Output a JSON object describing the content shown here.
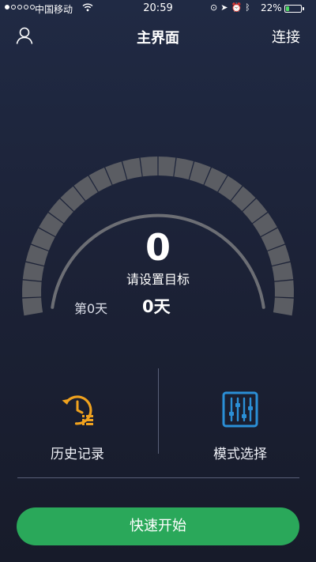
{
  "status_bar": {
    "carrier": "中国移动",
    "time": "20:59",
    "battery_percent": "22%",
    "battery_level": 0.22,
    "wifi_icon": "wifi-icon",
    "system_icons": [
      "orientation-lock-icon",
      "location-arrow-icon",
      "alarm-icon",
      "bluetooth-icon"
    ]
  },
  "header": {
    "title": "主界面",
    "connect_label": "连接",
    "profile_icon": "user-icon"
  },
  "gauge": {
    "value": "0",
    "hint": "请设置目标",
    "day_label": "第0天",
    "day_count": "0天",
    "progress": 0,
    "track_color": "#5b5d63",
    "inner_color": "#6c6e74"
  },
  "actions": {
    "history": {
      "label": "历史记录",
      "icon": "history-clock-icon",
      "color": "#f0a21e"
    },
    "mode": {
      "label": "模式选择",
      "icon": "sliders-icon",
      "color": "#2b8fd6"
    }
  },
  "start_button": {
    "label": "快速开始",
    "color": "#2aa85a"
  }
}
